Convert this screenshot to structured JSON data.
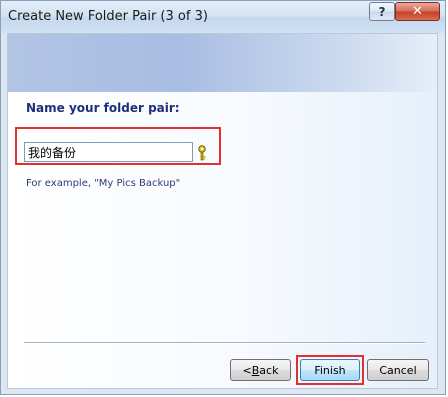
{
  "window": {
    "title": "Create New Folder Pair (3 of 3)",
    "help_glyph": "?",
    "close_glyph": "✕"
  },
  "main": {
    "heading": "Name your folder pair:",
    "folder_pair_name": "我的备份",
    "example": "For example, \"My Pics Backup\""
  },
  "footer": {
    "back_prefix": "< ",
    "back_mnemonic": "B",
    "back_rest": "ack",
    "finish_label": "Finish",
    "cancel_label": "Cancel"
  },
  "colors": {
    "highlight": "#e03030",
    "heading": "#1e2f7a",
    "banner": "#a8bde2"
  }
}
